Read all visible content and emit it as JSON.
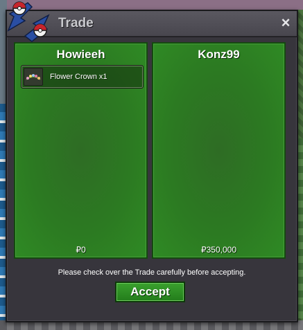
{
  "window": {
    "title": "Trade",
    "close_glyph": "×"
  },
  "traders": [
    {
      "name": "Howieeh",
      "items": [
        {
          "name": "Flower Crown",
          "quantity": "x1",
          "icon": "flower-crown-icon"
        }
      ],
      "money": "₽0"
    },
    {
      "name": "Konz99",
      "items": [],
      "money": "₽350,000"
    }
  ],
  "notice": "Please check over the Trade carefully before accepting.",
  "accept_label": "Accept",
  "colors": {
    "panel_green": "#2c7a22",
    "window_bg": "#37353c",
    "accept_green": "#2f8f25",
    "logo_blue": "#2a4ea3",
    "logo_red": "#c8242c"
  }
}
